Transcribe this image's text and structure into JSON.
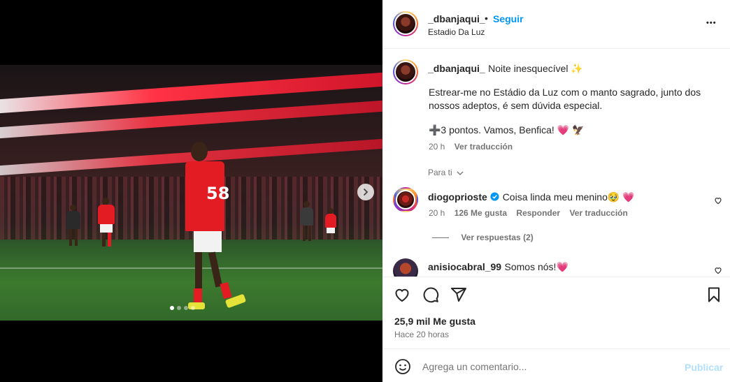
{
  "post": {
    "author": "_dbanjaqui_",
    "follow_label": "Seguir",
    "separator": "•",
    "location": "Estadio Da Luz",
    "more_label": "•••"
  },
  "media": {
    "jersey_number": "58",
    "carousel_count": 4,
    "carousel_active": 0
  },
  "caption": {
    "author": "_dbanjaqui_",
    "line1": "Noite inesquecível ✨",
    "body": "Estrear-me no Estádio da Luz com o manto sagrado, junto dos nossos adeptos, é sem dúvida especial.",
    "line3": "➕3 pontos. Vamos, Benfica! 💗 🦅",
    "time": "20 h",
    "translate": "Ver traducción"
  },
  "filter_label": "Para ti",
  "comments": [
    {
      "user": "diogoprioste",
      "verified": true,
      "text": "Coisa linda meu menino🥹 💗",
      "time": "20 h",
      "likes": "126 Me gusta",
      "reply": "Responder",
      "translate": "Ver traducción",
      "replies_label": "Ver respuestas (2)"
    },
    {
      "user": "anisiocabral_99",
      "text": "Somos nós!💗"
    }
  ],
  "stats": {
    "likes": "25,9 mil Me gusta",
    "time_ago": "Hace 20 horas"
  },
  "add_comment": {
    "placeholder": "Agrega un comentario...",
    "publish": "Publicar"
  },
  "colors": {
    "accent": "#0095f6",
    "follow": "#0095f6",
    "publish_disabled": "#b2dffc"
  }
}
